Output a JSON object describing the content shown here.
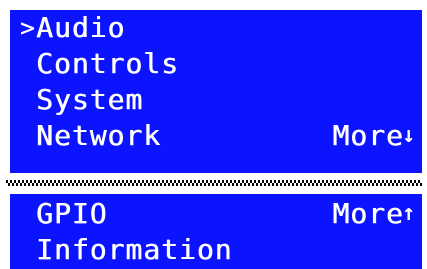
{
  "colors": {
    "background": "#ffffff",
    "panel": "#0c14ff",
    "text": "#ffffff",
    "divider": "#000000"
  },
  "menu_top": {
    "cursor": ">",
    "items": [
      {
        "label": "Audio"
      },
      {
        "label": "Controls"
      },
      {
        "label": "System"
      },
      {
        "label": "Network",
        "more_label": "More",
        "more_icon": "down-arrow-icon",
        "more_glyph": "↓"
      }
    ]
  },
  "menu_bottom": {
    "items": [
      {
        "label": "GPIO",
        "more_label": "More",
        "more_icon": "up-arrow-icon",
        "more_glyph": "↑"
      },
      {
        "label": "Information"
      }
    ]
  }
}
